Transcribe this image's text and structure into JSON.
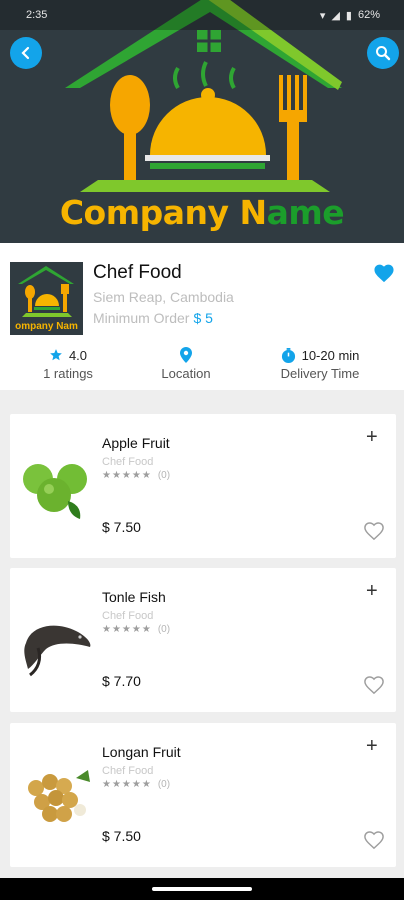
{
  "status_bar": {
    "time": "2:35",
    "battery": "62%"
  },
  "header": {
    "company_name_part1": "Company N",
    "company_name_part2": "ame",
    "back_icon": "chevron-left-icon",
    "search_icon": "search-icon"
  },
  "restaurant": {
    "thumb_text": "ompany Nam",
    "name": "Chef Food",
    "location": "Siem Reap, Cambodia",
    "min_order_label": "Minimum Order",
    "min_order_value": "$ 5",
    "rating": "4.0",
    "ratings_count": "1 ratings",
    "location_label": "Location",
    "delivery_time": "10-20 min",
    "delivery_label": "Delivery Time"
  },
  "products": [
    {
      "name": "Apple Fruit",
      "shop": "Chef Food",
      "stars": "★★★★★",
      "reviews": "(0)",
      "price": "$ 7.50"
    },
    {
      "name": "Tonle Fish",
      "shop": "Chef Food",
      "stars": "★★★★★",
      "reviews": "(0)",
      "price": "$ 7.70"
    },
    {
      "name": "Longan Fruit",
      "shop": "Chef Food",
      "stars": "★★★★★",
      "reviews": "(0)",
      "price": "$ 7.50"
    }
  ],
  "colors": {
    "accent": "#13a4ea",
    "brand_orange": "#f6b400",
    "brand_green": "#1b9e2b",
    "header_bg": "#303b41"
  }
}
